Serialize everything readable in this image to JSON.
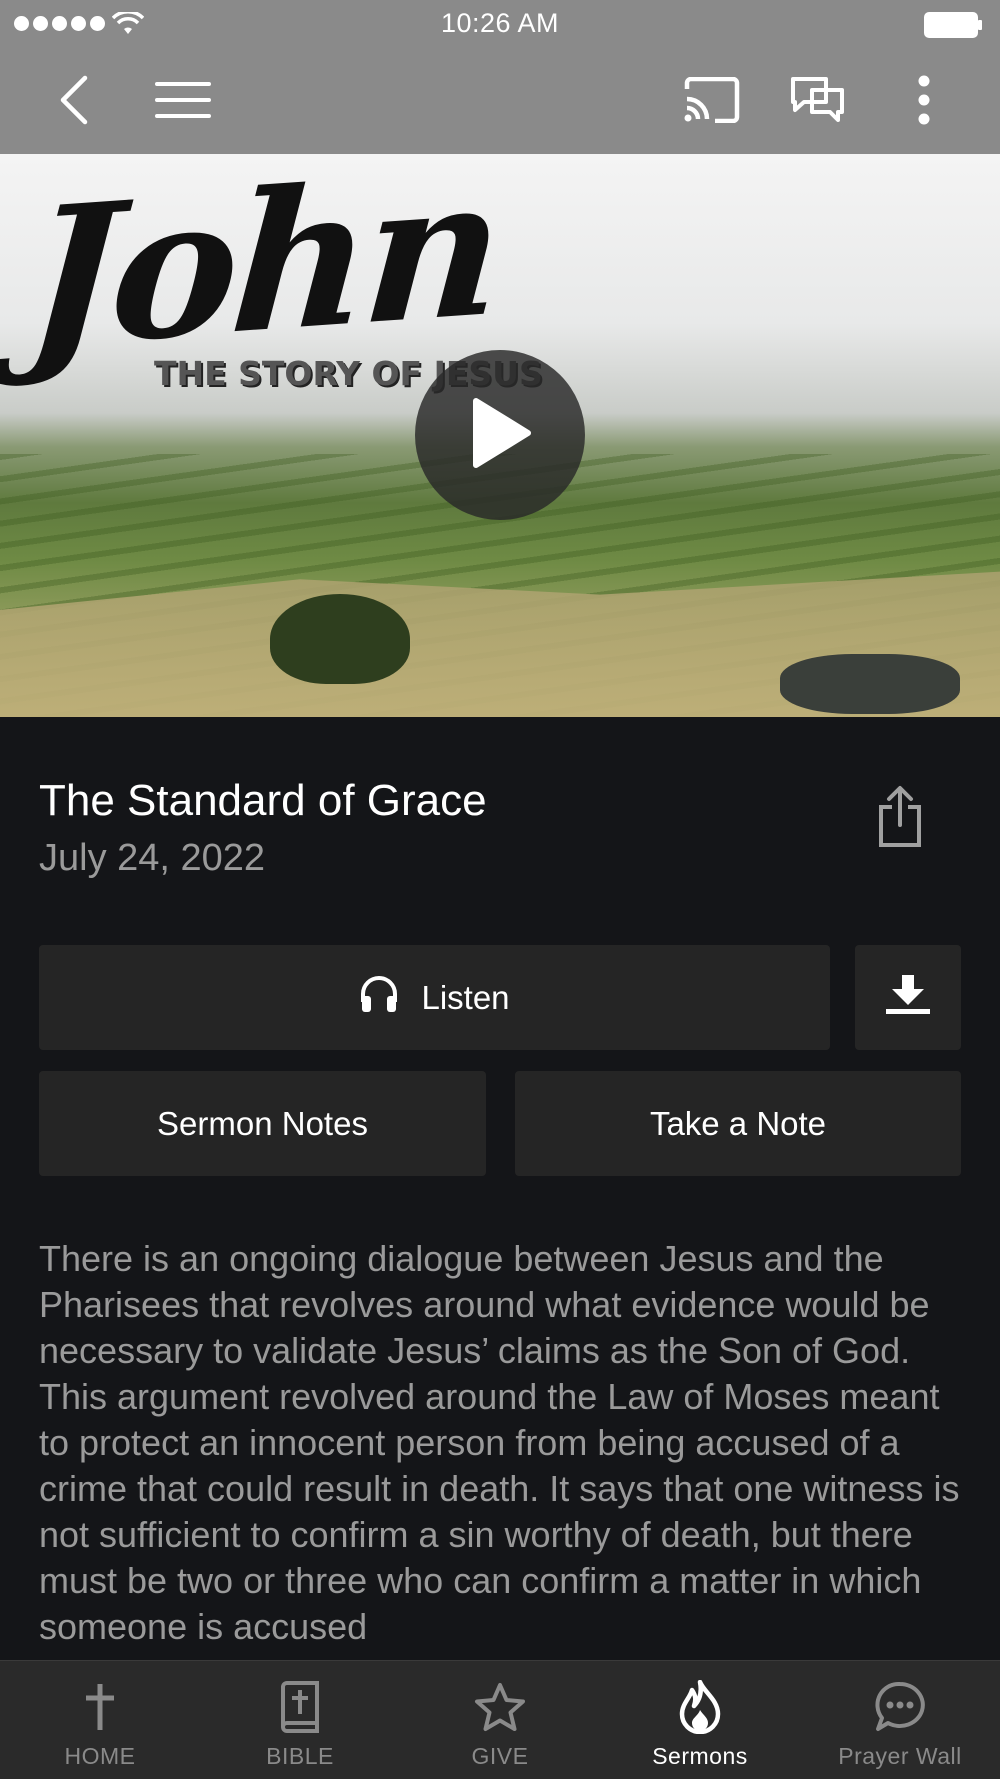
{
  "status_bar": {
    "time": "10:26 AM"
  },
  "hero": {
    "title": "John",
    "subtitle": "THE STORY OF JESUS"
  },
  "sermon": {
    "title": "The Standard of Grace",
    "date": "July 24, 2022",
    "description": "There is an ongoing dialogue between Jesus and the Pharisees that revolves around what evidence would be necessary to validate Jesus’ claims as the Son of God. This argument revolved around the Law of Moses meant to protect an innocent person from being accused of a crime that could result in death. It says that one witness is not sufficient to confirm a sin worthy of death, but there must be two or three who can confirm a matter in which someone is accused"
  },
  "actions": {
    "listen_label": "Listen",
    "sermon_notes_label": "Sermon Notes",
    "take_note_label": "Take a Note"
  },
  "tabs": [
    {
      "label": "HOME",
      "icon": "cross-icon"
    },
    {
      "label": "BIBLE",
      "icon": "bible-icon"
    },
    {
      "label": "GIVE",
      "icon": "star-icon"
    },
    {
      "label": "Sermons",
      "icon": "flame-icon",
      "active": true
    },
    {
      "label": "Prayer Wall",
      "icon": "chat-bubble-icon"
    }
  ],
  "colors": {
    "nav_background": "#8a8a8a",
    "page_background": "#141518",
    "button_background": "#252525",
    "muted_text": "#9a9a9a",
    "tab_bar_background": "#2a2a2a"
  }
}
